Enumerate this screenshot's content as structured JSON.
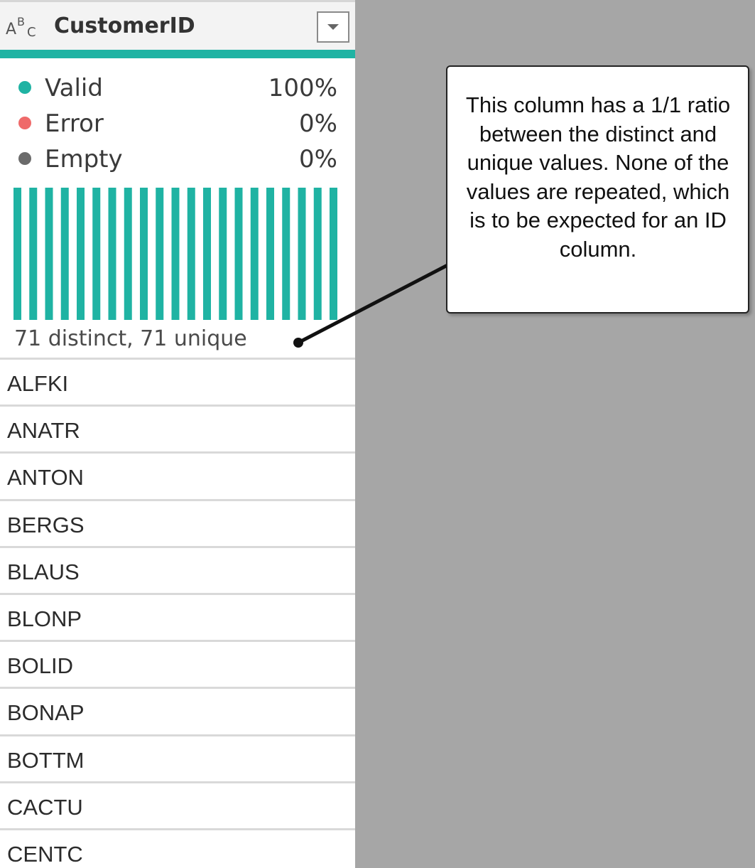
{
  "column": {
    "type_icon": {
      "a": "A",
      "b": "B",
      "c": "C"
    },
    "name": "CustomerID",
    "dropdown_icon": "chevron-down-icon"
  },
  "quality": {
    "items": [
      {
        "label": "Valid",
        "percent": "100%",
        "color": "#1fb3a3"
      },
      {
        "label": "Error",
        "percent": "0%",
        "color": "#ef6a6a"
      },
      {
        "label": "Empty",
        "percent": "0%",
        "color": "#6b6b6b"
      }
    ]
  },
  "distribution": {
    "bar_count": 21,
    "bar_color": "#1fb3a3",
    "summary": "71 distinct, 71 unique"
  },
  "values": [
    "ALFKI",
    "ANATR",
    "ANTON",
    "BERGS",
    "BLAUS",
    "BLONP",
    "BOLID",
    "BONAP",
    "BOTTM",
    "CACTU",
    "CENTC"
  ],
  "callout": {
    "text": "This column has a 1/1 ratio between the distinct and unique values. None of the values are repeated, which is to be expected for an ID column."
  }
}
